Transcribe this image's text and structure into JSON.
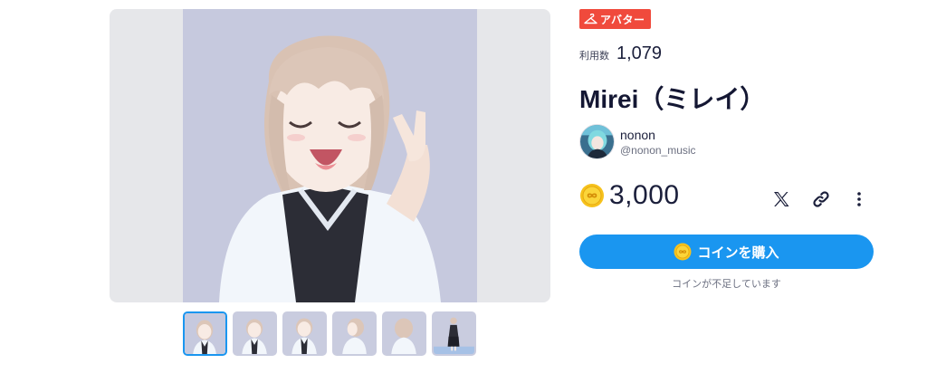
{
  "badge": {
    "label": "アバター",
    "icon": "hanger-icon",
    "color": "#f04a3c"
  },
  "usage": {
    "label": "利用数",
    "value": "1,079"
  },
  "title": "Mirei（ミレイ）",
  "author": {
    "name": "nonon",
    "handle": "@nonon_music"
  },
  "price": {
    "value": "3,000",
    "icon": "coin-icon"
  },
  "actions": {
    "share_x": "x-logo-icon",
    "copy_link": "link-icon",
    "more": "more-vertical-icon"
  },
  "buy_button": {
    "label": "コインを購入",
    "color": "#1a96f0"
  },
  "note": "コインが不足しています",
  "gallery": {
    "selected_index": 0,
    "thumbnail_count": 6
  }
}
